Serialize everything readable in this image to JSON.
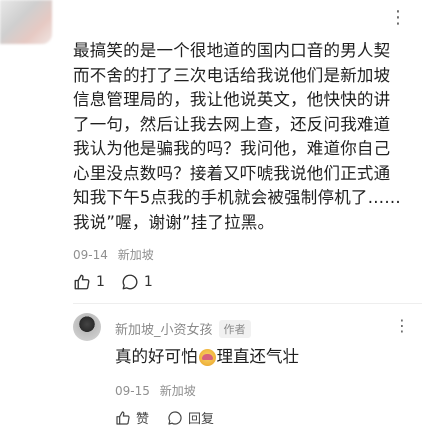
{
  "comment": {
    "text": "最搞笑的是一个很地道的国内口音的男人契\n而不舍的打了三次电话给我说他们是新加坡\n信息管理局的，我让他说英文，他快快的讲\n了一句，然后让我去网上查，还反问我难道\n我认为他是骗我的吗？我问他，难道你自己\n心里没点数吗？接着又吓唬我说他们正式通\n知我下午5点我的手机就会被强制停机了……\n我说”喔，谢谢”挂了拉黑。",
    "date": "09-14",
    "location": "新加坡",
    "like_count": "1",
    "reply_count": "1"
  },
  "reply": {
    "author": "新加坡_小资女孩",
    "author_badge": "作者",
    "text_before": "真的好可怕",
    "text_after": "理直还气壮",
    "date": "09-15",
    "location": "新加坡",
    "like_label": "赞",
    "reply_label": "回复"
  },
  "icons": {
    "more": "more-horizontal-icon",
    "like": "thumbs-up-icon",
    "comment": "comment-bubble-icon",
    "emoji": "scared-face-emoji-icon"
  }
}
